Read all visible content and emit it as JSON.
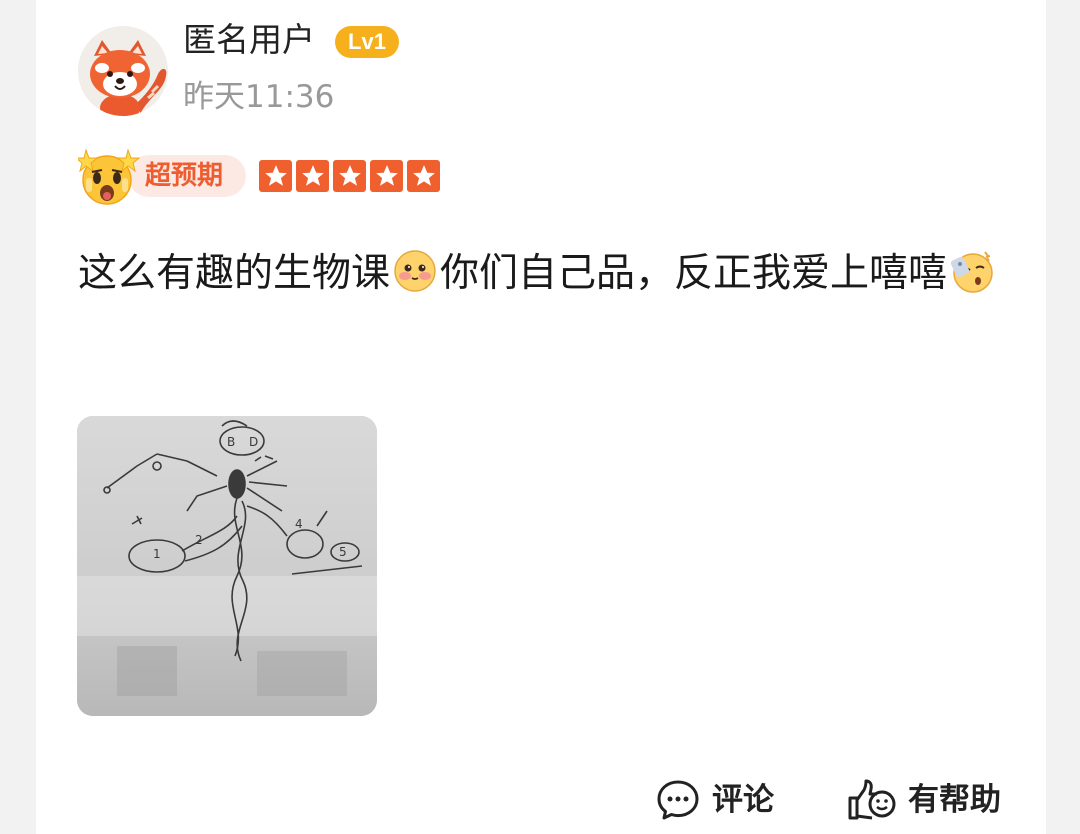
{
  "review": {
    "user": {
      "name": "匿名用户",
      "level": "Lv1",
      "avatar_icon": "red-panda-avatar-icon"
    },
    "time": "昨天11:36",
    "rating": {
      "tag_label": "超预期",
      "tag_icon": "star-struck-face-icon",
      "stars": 5,
      "stars_max": 5
    },
    "text": {
      "part1": "这么有趣的生物课",
      "emoji1": "blushing-face-icon",
      "part2": "你们自己品，反正我爱上嘻嘻",
      "emoji2": "smirking-yawn-face-icon"
    },
    "photo": {
      "icon": "whiteboard-drawing-photo"
    },
    "actions": {
      "comment_label": "评论",
      "helpful_label": "有帮助"
    }
  },
  "colors": {
    "accent": "#f0602f",
    "level_badge": "#f6b01b",
    "tag_bg": "#fde9e3",
    "secondary_text": "#999999"
  }
}
